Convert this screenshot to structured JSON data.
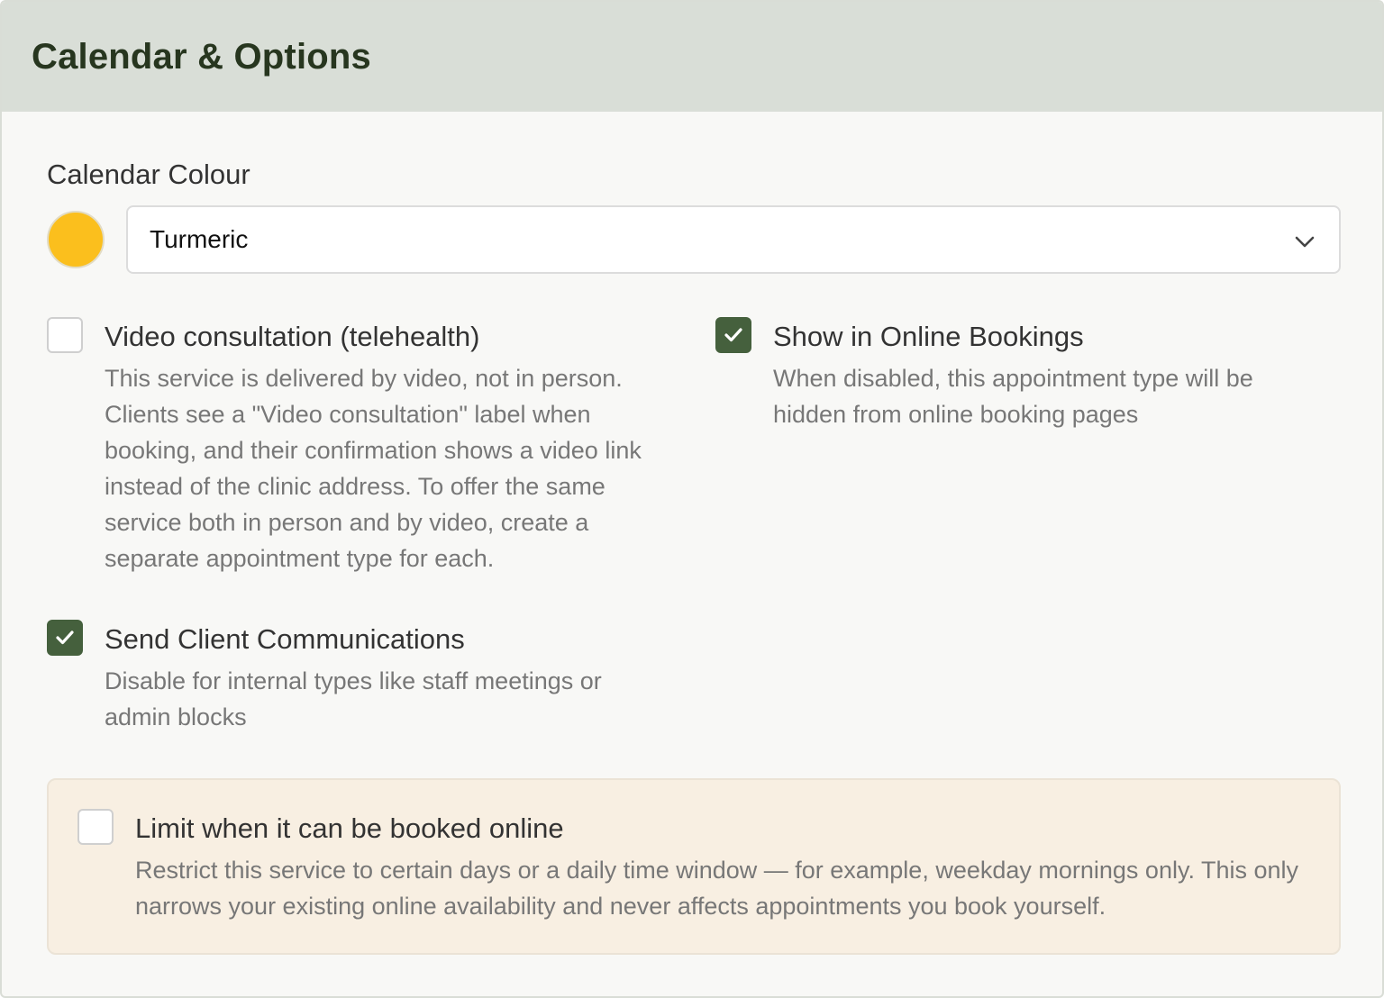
{
  "header": {
    "title": "Calendar & Options"
  },
  "calendar_colour": {
    "label": "Calendar Colour",
    "swatch_color": "#fbbf1d",
    "selected": "Turmeric"
  },
  "options": {
    "video": {
      "title": "Video consultation (telehealth)",
      "description": "This service is delivered by video, not in person. Clients see a \"Video consultation\" label when booking, and their confirmation shows a video link instead of the clinic address. To offer the same service both in person and by video, create a separate appointment type for each.",
      "checked": false
    },
    "online_bookings": {
      "title": "Show in Online Bookings",
      "description": "When disabled, this appointment type will be hidden from online booking pages",
      "checked": true
    },
    "client_comms": {
      "title": "Send Client Communications",
      "description": "Disable for internal types like staff meetings or admin blocks",
      "checked": true
    },
    "limit_online": {
      "title": "Limit when it can be booked online",
      "description": "Restrict this service to certain days or a daily time window — for example, weekday mornings only. This only narrows your existing online availability and never affects appointments you book yourself.",
      "checked": false
    }
  },
  "colors": {
    "accent": "#45603d",
    "header_bg": "#d9ded7",
    "notice_bg": "#f8efe2"
  }
}
